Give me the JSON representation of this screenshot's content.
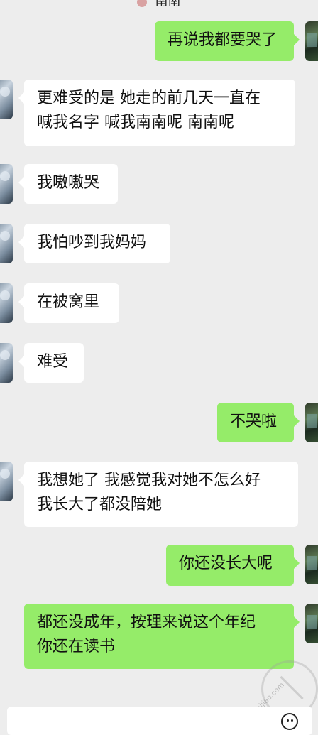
{
  "header": {
    "title_peek": "南南"
  },
  "messages": [
    {
      "side": "right",
      "text": "再说我都要哭了"
    },
    {
      "side": "left",
      "text": "更难受的是 她走的前几天一直在\n喊我名字 喊我南南呢 南南呢"
    },
    {
      "side": "left",
      "text": "我嗷嗷哭"
    },
    {
      "side": "left",
      "text": "我怕吵到我妈妈"
    },
    {
      "side": "left",
      "text": "在被窝里"
    },
    {
      "side": "left",
      "text": "难受"
    },
    {
      "side": "right",
      "text": "不哭啦"
    },
    {
      "side": "left",
      "text": "我想她了 我感觉我对她不怎么好\n我长大了都没陪她"
    },
    {
      "side": "right",
      "text": "你还没长大呢"
    },
    {
      "side": "right",
      "text": "都还没成年，按理来说这个年纪\n你还在读书"
    }
  ],
  "watermark": {
    "text": "haijiao.com"
  },
  "icons": {
    "input_emoji": "emoji-icon"
  },
  "colors": {
    "background": "#ededed",
    "sent_bubble": "#95ec69",
    "received_bubble": "#ffffff"
  }
}
